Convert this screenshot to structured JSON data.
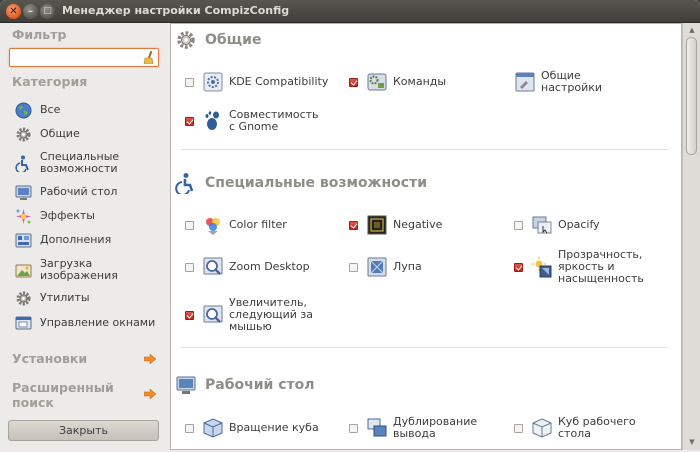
{
  "window": {
    "title": "Менеджер настройки CompizConfig"
  },
  "window_buttons": {
    "close": "✕",
    "minimize": "–",
    "maximize": "□"
  },
  "sidebar": {
    "filter_label": "Фильтр",
    "filter_value": "",
    "category_label": "Категория",
    "categories": [
      {
        "label": "Все",
        "icon": "globe-icon"
      },
      {
        "label": "Общие",
        "icon": "gear-icon"
      },
      {
        "label": "Специальные возможности",
        "icon": "accessibility-icon"
      },
      {
        "label": "Рабочий стол",
        "icon": "desktop-icon"
      },
      {
        "label": "Эффекты",
        "icon": "effects-icon"
      },
      {
        "label": "Дополнения",
        "icon": "extras-icon"
      },
      {
        "label": "Загрузка изображения",
        "icon": "image-loading-icon"
      },
      {
        "label": "Утилиты",
        "icon": "utility-icon"
      },
      {
        "label": "Управление окнами",
        "icon": "window-management-icon"
      }
    ],
    "settings_label": "Установки",
    "advanced_search_label": "Расширенный поиск",
    "close_button_label": "Закрыть"
  },
  "groups": [
    {
      "title": "Общие",
      "icon": "gear-icon",
      "plugins": [
        {
          "label": "KDE Compatibility",
          "checked": false,
          "icon": "kde-compat-icon"
        },
        {
          "label": "Команды",
          "checked": true,
          "icon": "commands-icon"
        },
        {
          "label": "Общие настройки",
          "checked": null,
          "icon": "general-options-icon"
        },
        {
          "label": "Совместимость с Gnome",
          "checked": true,
          "icon": "gnome-icon"
        }
      ]
    },
    {
      "title": "Специальные возможности",
      "icon": "accessibility-icon",
      "plugins": [
        {
          "label": "Color filter",
          "checked": false,
          "icon": "color-filter-icon"
        },
        {
          "label": "Negative",
          "checked": true,
          "icon": "negative-icon"
        },
        {
          "label": "Opacify",
          "checked": false,
          "icon": "opacify-icon"
        },
        {
          "label": "Zoom Desktop",
          "checked": false,
          "icon": "zoom-desktop-icon"
        },
        {
          "label": "Лупа",
          "checked": false,
          "icon": "magnifier-icon"
        },
        {
          "label": "Прозрачность, яркость и насыщенность",
          "checked": true,
          "icon": "opacity-brightness-icon"
        },
        {
          "label": "Увеличитель, следующий за мышью",
          "checked": true,
          "icon": "mouse-zoom-icon"
        }
      ]
    },
    {
      "title": "Рабочий стол",
      "icon": "desktop-icon",
      "plugins": [
        {
          "label": "Вращение куба",
          "checked": false,
          "icon": "rotate-cube-icon"
        },
        {
          "label": "Дублирование вывода",
          "checked": false,
          "icon": "clone-output-icon"
        },
        {
          "label": "Куб рабочего стола",
          "checked": false,
          "icon": "desktop-cube-icon"
        }
      ]
    }
  ],
  "colors": {
    "accent": "#e2571d",
    "checked": "#c0271c",
    "title_bar": "#3f3e3a",
    "section_heading": "#8f8d88"
  }
}
